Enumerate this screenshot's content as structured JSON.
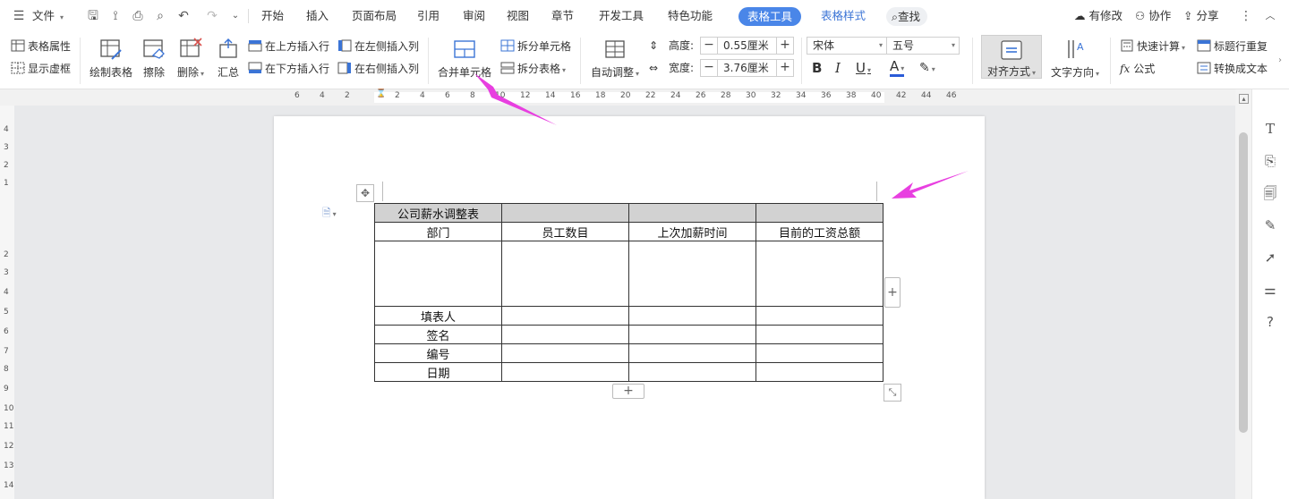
{
  "menubar": {
    "file_label": "文件",
    "tabs": [
      {
        "label": "开始"
      },
      {
        "label": "插入"
      },
      {
        "label": "页面布局"
      },
      {
        "label": "引用"
      },
      {
        "label": "审阅"
      },
      {
        "label": "视图"
      },
      {
        "label": "章节"
      },
      {
        "label": "开发工具"
      },
      {
        "label": "特色功能"
      },
      {
        "label": "表格工具"
      },
      {
        "label": "表格样式"
      }
    ],
    "search_label": "查找",
    "status_label": "有修改",
    "collab_label": "协作",
    "share_label": "分享"
  },
  "ribbon": {
    "table_props": "表格属性",
    "show_gridlines": "显示虚框",
    "draw_table": "绘制表格",
    "erase": "擦除",
    "delete": "删除",
    "summary": "汇总",
    "insert_row_above": "在上方插入行",
    "insert_row_below": "在下方插入行",
    "insert_col_left": "在左侧插入列",
    "insert_col_right": "在右侧插入列",
    "merge_cells": "合并单元格",
    "split_cells": "拆分单元格",
    "split_table": "拆分表格",
    "auto_fit": "自动调整",
    "height_label": "高度:",
    "height_value": "0.55厘米",
    "width_label": "宽度:",
    "width_value": "3.76厘米",
    "font_name": "宋体",
    "font_size": "五号",
    "bold": "B",
    "italic": "I",
    "underline": "U",
    "font_color_letter": "A",
    "align": "对齐方式",
    "text_direction": "文字方向",
    "quick_calc": "快速计算",
    "formula": "公式",
    "repeat_header": "标题行重复",
    "to_text": "转换成文本"
  },
  "ruler": {
    "horizontal": [
      "6",
      "4",
      "2",
      "2",
      "4",
      "6",
      "8",
      "10",
      "12",
      "14",
      "16",
      "18",
      "20",
      "22",
      "24",
      "26",
      "28",
      "30",
      "32",
      "34",
      "36",
      "38",
      "40",
      "42",
      "44",
      "46"
    ],
    "vertical": [
      "4",
      "3",
      "2",
      "1",
      "2",
      "3",
      "4",
      "5",
      "6",
      "7",
      "8",
      "9",
      "10",
      "11",
      "12",
      "13",
      "14"
    ]
  },
  "table": {
    "title": "公司薪水调整表",
    "headers": [
      "部门",
      "员工数目",
      "上次加薪时间",
      "目前的工资总额"
    ],
    "row_labels": [
      "填表人",
      "签名",
      "编号",
      "日期"
    ]
  },
  "colors": {
    "accent": "#4a86e8",
    "annotation_arrow": "#e83fe0",
    "title_row_fill": "#d2d2d2"
  }
}
